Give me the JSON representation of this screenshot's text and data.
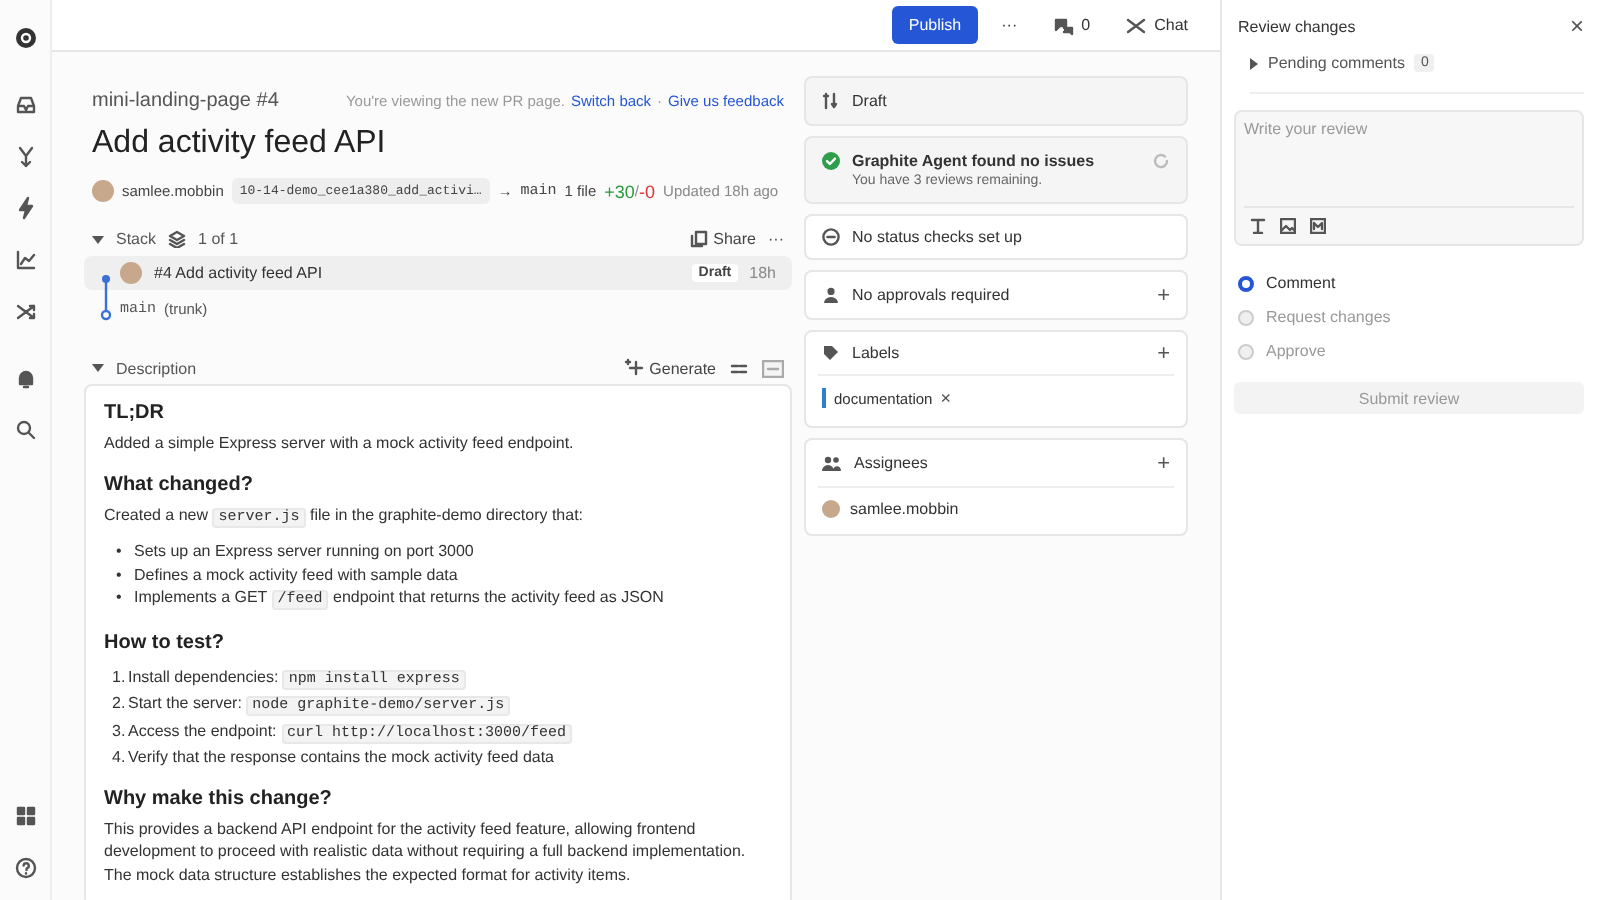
{
  "topbar": {
    "publish": "Publish",
    "more": "···",
    "comments_count": "0",
    "chat": "Chat"
  },
  "header": {
    "repo": "mini-landing-page #4",
    "notice": "You're viewing the new PR page.",
    "switch_back": "Switch back",
    "separator": "·",
    "feedback": "Give us feedback",
    "title": "Add activity feed API",
    "author": "samlee.mobbin",
    "branch": "10-14-demo_cee1a380_add_activi…",
    "arrow": "→",
    "base": "main",
    "files": "1 file",
    "additions": "+30",
    "slash": "/",
    "deletions": "-0",
    "updated": "Updated 18h ago"
  },
  "stack": {
    "label": "Stack",
    "count": "1 of 1",
    "expanded": true,
    "share": "Share",
    "more": "···",
    "items": [
      {
        "title": "#4 Add activity feed API",
        "status": "Draft",
        "age": "18h",
        "selected": true
      }
    ],
    "trunk": {
      "branch": "main",
      "note": "(trunk)"
    }
  },
  "description": {
    "label": "Description",
    "expanded": true,
    "generate": "Generate",
    "blocks": [
      {
        "kind": "heading",
        "text": "TL;DR"
      },
      {
        "kind": "paragraph",
        "parts": [
          {
            "kind": "text",
            "text": "Added a simple Express server with a mock activity feed endpoint."
          }
        ]
      },
      {
        "kind": "heading",
        "text": "What changed?"
      },
      {
        "kind": "paragraph",
        "parts": [
          {
            "kind": "text",
            "text": "Created a new "
          },
          {
            "kind": "code",
            "text": "server.js"
          },
          {
            "kind": "text",
            "text": " file in the graphite-demo directory that:"
          }
        ]
      },
      {
        "kind": "bullets",
        "items": [
          {
            "marker": "•",
            "parts": [
              {
                "kind": "text",
                "text": "Sets up an Express server running on port 3000"
              }
            ]
          },
          {
            "marker": "•",
            "parts": [
              {
                "kind": "text",
                "text": "Defines a mock activity feed with sample data"
              }
            ]
          },
          {
            "marker": "•",
            "parts": [
              {
                "kind": "text",
                "text": "Implements a GET "
              },
              {
                "kind": "code",
                "text": "/feed"
              },
              {
                "kind": "text",
                "text": " endpoint that returns the activity feed as JSON"
              }
            ]
          }
        ]
      },
      {
        "kind": "heading",
        "text": "How to test?"
      },
      {
        "kind": "numbered",
        "items": [
          {
            "marker": "1.",
            "parts": [
              {
                "kind": "text",
                "text": "Install dependencies: "
              },
              {
                "kind": "code",
                "text": "npm install express"
              }
            ]
          },
          {
            "marker": "2.",
            "parts": [
              {
                "kind": "text",
                "text": "Start the server: "
              },
              {
                "kind": "code",
                "text": "node graphite-demo/server.js"
              }
            ]
          },
          {
            "marker": "3.",
            "parts": [
              {
                "kind": "text",
                "text": "Access the endpoint: "
              },
              {
                "kind": "code",
                "text": "curl http://localhost:3000/feed"
              }
            ]
          },
          {
            "marker": "4.",
            "parts": [
              {
                "kind": "text",
                "text": "Verify that the response contains the mock activity feed data"
              }
            ]
          }
        ]
      },
      {
        "kind": "heading",
        "text": "Why make this change?"
      },
      {
        "kind": "paragraph",
        "parts": [
          {
            "kind": "text",
            "text": "This provides a backend API endpoint for the activity feed feature, allowing frontend development to proceed with realistic data without requiring a full backend implementation. The mock data structure establishes the expected format for activity items."
          }
        ]
      }
    ]
  },
  "side": {
    "status": "Draft",
    "agent": {
      "title": "Graphite Agent found no issues",
      "subtitle": "You have 3 reviews remaining.",
      "passed": true
    },
    "checks": "No status checks set up",
    "approvals": "No approvals required",
    "add": "+",
    "labels": {
      "title": "Labels",
      "items": [
        {
          "name": "documentation",
          "color": "#2f7fd0",
          "remove": "×"
        }
      ]
    },
    "assignees": {
      "title": "Assignees",
      "items": [
        {
          "name": "samlee.mobbin"
        }
      ]
    }
  },
  "review": {
    "title": "Review changes",
    "close": "×",
    "pending": {
      "label": "Pending comments",
      "count": "0",
      "expanded": false
    },
    "placeholder": "Write your review",
    "options": [
      {
        "label": "Comment",
        "selected": true
      },
      {
        "label": "Request changes",
        "selected": false
      },
      {
        "label": "Approve",
        "selected": false
      }
    ],
    "submit": {
      "label": "Submit review",
      "disabled": true
    }
  }
}
